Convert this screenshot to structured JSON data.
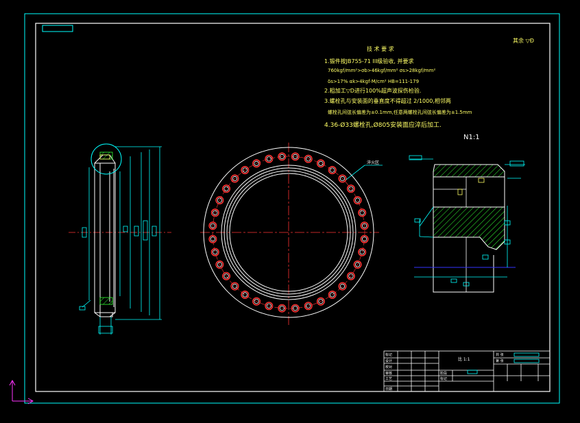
{
  "drawing": {
    "roughness": "其余 ▽Ð",
    "requirements_title": "技 术 要 求",
    "requirements": [
      "1.锻件按JB755-71 III级验收, 并要求",
      "  760kgf/mm²>σb>46kgf/mm²  σs>28kgf/mm²",
      "  δs>17%        αk>4kgf·M/cm²  HB=111-179",
      "2.粗加工▽D进行100%超声波探伤检验.",
      "3.螺栓孔与安装面的垂直度不得超过 2/1000,相邻两",
      "  螺栓孔间弦长偏差为±0.1mm,任意两螺栓孔间弦长偏差为±1.5mm",
      "4.36-Ø33螺栓孔,Ø805安装面应淬后加工."
    ],
    "section_label": "N1:1",
    "callout_label": "淬火区"
  },
  "title_block": {
    "scale": "比 1:1",
    "left_labels": [
      "标记",
      "设计",
      "校对",
      "审核",
      "工艺",
      "日期"
    ],
    "mid_labels": [
      "阶段",
      "标记"
    ],
    "right_labels": [
      "共  张",
      "第  张"
    ]
  },
  "colors": {
    "background": "#000000",
    "frame": "#ffffff",
    "outer_border": "#00ffff",
    "geometry": "#ffffff",
    "dimensions": "#00ffff",
    "centerline": "#ff3333",
    "hatch": "#33ff33",
    "hidden": "#3333ff",
    "bolt_holes": "#ff3333",
    "axis": "#ff33ff",
    "notes": "#ffff66"
  }
}
